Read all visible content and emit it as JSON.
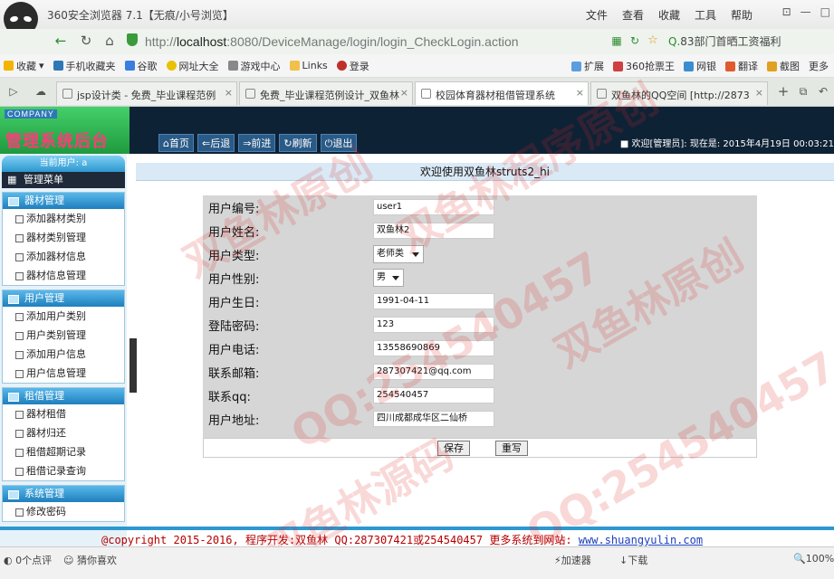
{
  "browser": {
    "title": "360安全浏览器 7.1【无痕/小号浏览】",
    "menu": [
      "文件",
      "查看",
      "收藏",
      "工具",
      "帮助"
    ],
    "url_prefix": "http://",
    "url_host": "localhost",
    "url_rest": ":8080/DeviceManage/login/login_CheckLogin.action",
    "search_text": "83部门首晒工资福利",
    "favorites": [
      "收藏",
      "手机收藏夹",
      "谷歌",
      "网址大全",
      "游戏中心",
      "Links",
      "登录"
    ],
    "favorites_right": [
      "扩展",
      "360抢票王",
      "网银",
      "翻译",
      "截图",
      "更多"
    ],
    "tabs": [
      {
        "label": "jsp设计类 - 免费_毕业课程范例"
      },
      {
        "label": "免费_毕业课程范例设计_双鱼林"
      },
      {
        "label": "校园体育器材租借管理系统"
      },
      {
        "label": "双鱼林的QQ空间 [http://2873"
      }
    ],
    "status": {
      "comments": "0个点评",
      "guess": "猜你喜欢",
      "accelerator": "加速器",
      "download": "下载",
      "zoom": "100%"
    }
  },
  "app": {
    "company": "COMPANY",
    "system_title": "管理系统后台",
    "toolbar": [
      "首页",
      "后退",
      "前进",
      "刷新",
      "退出"
    ],
    "status_line": "欢迎[管理员]:  现在是: 2015年4月19日  00:03:21",
    "current_user": "当前用户: a",
    "menu_header": "管理菜单",
    "groups": [
      {
        "title": "器材管理",
        "items": [
          "添加器材类别",
          "器材类别管理",
          "添加器材信息",
          "器材信息管理"
        ]
      },
      {
        "title": "用户管理",
        "items": [
          "添加用户类别",
          "用户类别管理",
          "添加用户信息",
          "用户信息管理"
        ]
      },
      {
        "title": "租借管理",
        "items": [
          "器材租借",
          "器材归还",
          "租借超期记录",
          "租借记录查询"
        ]
      },
      {
        "title": "系统管理",
        "items": [
          "修改密码"
        ]
      }
    ],
    "welcome": "欢迎使用双鱼林struts2_hi",
    "form": {
      "fields": [
        {
          "label": "用户编号:",
          "value": "user1",
          "type": "text"
        },
        {
          "label": "用户姓名:",
          "value": "双鱼林2",
          "type": "text"
        },
        {
          "label": "用户类型:",
          "value": "老师类",
          "type": "select"
        },
        {
          "label": "用户性别:",
          "value": "男",
          "type": "select"
        },
        {
          "label": "用户生日:",
          "value": "1991-04-11",
          "type": "text"
        },
        {
          "label": "登陆密码:",
          "value": "123",
          "type": "text"
        },
        {
          "label": "用户电话:",
          "value": "13558690869",
          "type": "text"
        },
        {
          "label": "联系邮箱:",
          "value": "287307421@qq.com",
          "type": "text"
        },
        {
          "label": "联系qq:",
          "value": "254540457",
          "type": "text"
        },
        {
          "label": "用户地址:",
          "value": "四川成都成华区二仙桥",
          "type": "text"
        }
      ],
      "save_label": "保存",
      "reset_label": "重写"
    },
    "copyright": "@copyright 2015-2016, 程序开发:双鱼林  QQ:287307421或254540457  更多系统到网站: ",
    "copyright_link": "www.shuangyulin.com"
  },
  "watermarks": [
    "双鱼林原创",
    "双鱼林程序原创",
    "QQ:254540457",
    "双鱼林原创",
    "双鱼林源码",
    "QQ:254540457"
  ]
}
